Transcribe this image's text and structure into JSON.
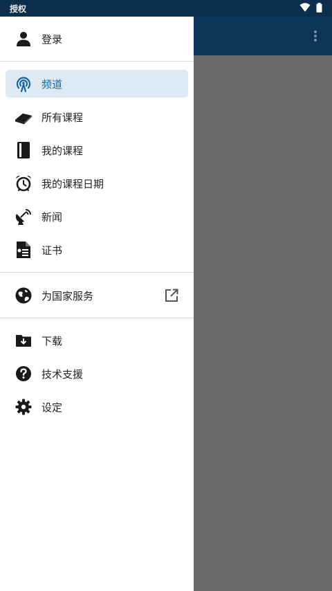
{
  "status_bar": {
    "left_text": "授权",
    "wifi_icon": "wifi-icon",
    "battery_icon": "battery-icon"
  },
  "app_bar": {
    "overflow_icon": "more-vert-icon"
  },
  "drawer": {
    "login": {
      "label": "登录",
      "icon": "person-icon"
    },
    "main_items": [
      {
        "label": "频道",
        "icon": "broadcast-icon",
        "active": true
      },
      {
        "label": "所有课程",
        "icon": "book-stack-icon"
      },
      {
        "label": "我的课程",
        "icon": "book-icon"
      },
      {
        "label": "我的课程日期",
        "icon": "alarm-clock-icon"
      },
      {
        "label": "新闻",
        "icon": "satellite-dish-icon"
      },
      {
        "label": "证书",
        "icon": "certificate-icon"
      }
    ],
    "external_item": {
      "label": "为国家服务",
      "icon": "globe-icon",
      "trailing_icon": "open-in-new-icon"
    },
    "bottom_items": [
      {
        "label": "下载",
        "icon": "download-folder-icon"
      },
      {
        "label": "技术支援",
        "icon": "help-icon"
      },
      {
        "label": "设定",
        "icon": "settings-icon"
      }
    ]
  },
  "colors": {
    "status_bar": "#0b2f4c",
    "app_bar": "#0c3557",
    "scrim": "#6a6a6a",
    "active_bg": "#dde9f3",
    "active_text": "#1565a0"
  }
}
